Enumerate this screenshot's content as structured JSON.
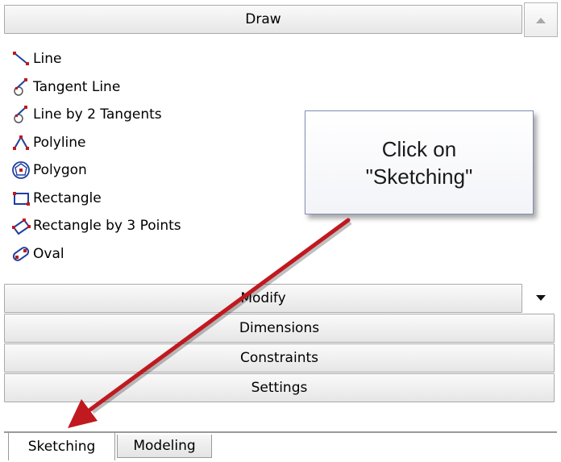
{
  "panel": {
    "draw_header": "Draw",
    "modify_header": "Modify",
    "dimensions_header": "Dimensions",
    "constraints_header": "Constraints",
    "settings_header": "Settings"
  },
  "draw_tools": [
    {
      "label": "Line",
      "icon": "line-icon"
    },
    {
      "label": "Tangent Line",
      "icon": "tangent-line-icon"
    },
    {
      "label": "Line by 2 Tangents",
      "icon": "line-by-2-tangents-icon"
    },
    {
      "label": "Polyline",
      "icon": "polyline-icon"
    },
    {
      "label": "Polygon",
      "icon": "polygon-icon"
    },
    {
      "label": "Rectangle",
      "icon": "rectangle-icon"
    },
    {
      "label": "Rectangle by 3 Points",
      "icon": "rectangle-3-points-icon"
    },
    {
      "label": "Oval",
      "icon": "oval-icon"
    }
  ],
  "tabs": {
    "sketching": "Sketching",
    "modeling": "Modeling"
  },
  "callout": {
    "line1": "Click on",
    "line2": "\"Sketching\""
  },
  "colors": {
    "arrow": "#c0191f",
    "callout_border": "#7e8fb0",
    "icon_blue": "#1f3fa0",
    "icon_red": "#c0191f"
  }
}
